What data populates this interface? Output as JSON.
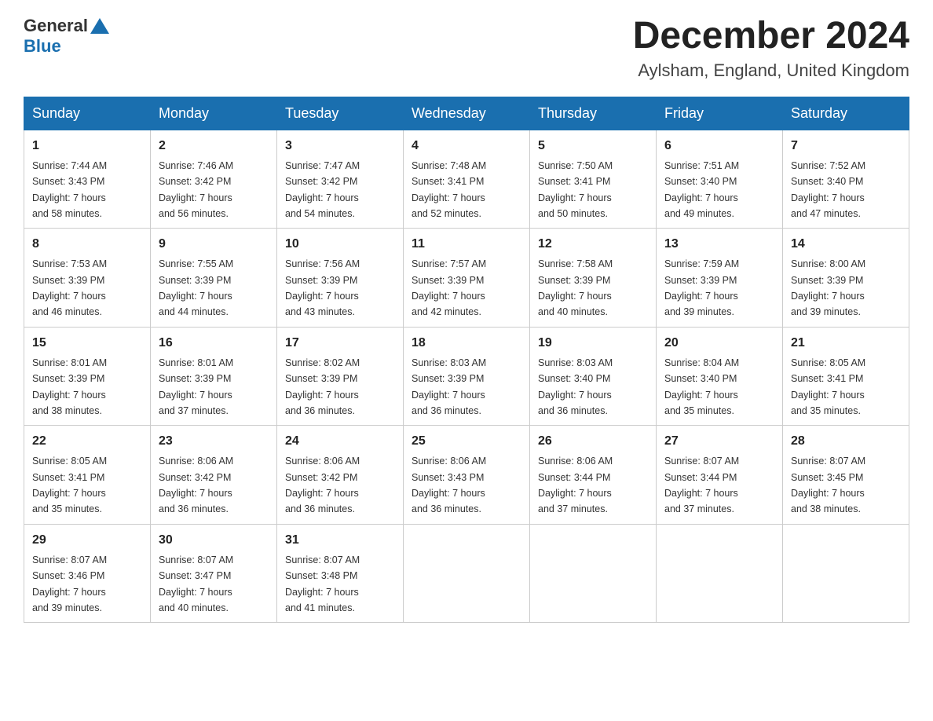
{
  "header": {
    "logo_general": "General",
    "logo_blue": "Blue",
    "month_title": "December 2024",
    "location": "Aylsham, England, United Kingdom"
  },
  "days_of_week": [
    "Sunday",
    "Monday",
    "Tuesday",
    "Wednesday",
    "Thursday",
    "Friday",
    "Saturday"
  ],
  "weeks": [
    [
      {
        "day": "1",
        "sunrise": "7:44 AM",
        "sunset": "3:43 PM",
        "daylight": "7 hours and 58 minutes."
      },
      {
        "day": "2",
        "sunrise": "7:46 AM",
        "sunset": "3:42 PM",
        "daylight": "7 hours and 56 minutes."
      },
      {
        "day": "3",
        "sunrise": "7:47 AM",
        "sunset": "3:42 PM",
        "daylight": "7 hours and 54 minutes."
      },
      {
        "day": "4",
        "sunrise": "7:48 AM",
        "sunset": "3:41 PM",
        "daylight": "7 hours and 52 minutes."
      },
      {
        "day": "5",
        "sunrise": "7:50 AM",
        "sunset": "3:41 PM",
        "daylight": "7 hours and 50 minutes."
      },
      {
        "day": "6",
        "sunrise": "7:51 AM",
        "sunset": "3:40 PM",
        "daylight": "7 hours and 49 minutes."
      },
      {
        "day": "7",
        "sunrise": "7:52 AM",
        "sunset": "3:40 PM",
        "daylight": "7 hours and 47 minutes."
      }
    ],
    [
      {
        "day": "8",
        "sunrise": "7:53 AM",
        "sunset": "3:39 PM",
        "daylight": "7 hours and 46 minutes."
      },
      {
        "day": "9",
        "sunrise": "7:55 AM",
        "sunset": "3:39 PM",
        "daylight": "7 hours and 44 minutes."
      },
      {
        "day": "10",
        "sunrise": "7:56 AM",
        "sunset": "3:39 PM",
        "daylight": "7 hours and 43 minutes."
      },
      {
        "day": "11",
        "sunrise": "7:57 AM",
        "sunset": "3:39 PM",
        "daylight": "7 hours and 42 minutes."
      },
      {
        "day": "12",
        "sunrise": "7:58 AM",
        "sunset": "3:39 PM",
        "daylight": "7 hours and 40 minutes."
      },
      {
        "day": "13",
        "sunrise": "7:59 AM",
        "sunset": "3:39 PM",
        "daylight": "7 hours and 39 minutes."
      },
      {
        "day": "14",
        "sunrise": "8:00 AM",
        "sunset": "3:39 PM",
        "daylight": "7 hours and 39 minutes."
      }
    ],
    [
      {
        "day": "15",
        "sunrise": "8:01 AM",
        "sunset": "3:39 PM",
        "daylight": "7 hours and 38 minutes."
      },
      {
        "day": "16",
        "sunrise": "8:01 AM",
        "sunset": "3:39 PM",
        "daylight": "7 hours and 37 minutes."
      },
      {
        "day": "17",
        "sunrise": "8:02 AM",
        "sunset": "3:39 PM",
        "daylight": "7 hours and 36 minutes."
      },
      {
        "day": "18",
        "sunrise": "8:03 AM",
        "sunset": "3:39 PM",
        "daylight": "7 hours and 36 minutes."
      },
      {
        "day": "19",
        "sunrise": "8:03 AM",
        "sunset": "3:40 PM",
        "daylight": "7 hours and 36 minutes."
      },
      {
        "day": "20",
        "sunrise": "8:04 AM",
        "sunset": "3:40 PM",
        "daylight": "7 hours and 35 minutes."
      },
      {
        "day": "21",
        "sunrise": "8:05 AM",
        "sunset": "3:41 PM",
        "daylight": "7 hours and 35 minutes."
      }
    ],
    [
      {
        "day": "22",
        "sunrise": "8:05 AM",
        "sunset": "3:41 PM",
        "daylight": "7 hours and 35 minutes."
      },
      {
        "day": "23",
        "sunrise": "8:06 AM",
        "sunset": "3:42 PM",
        "daylight": "7 hours and 36 minutes."
      },
      {
        "day": "24",
        "sunrise": "8:06 AM",
        "sunset": "3:42 PM",
        "daylight": "7 hours and 36 minutes."
      },
      {
        "day": "25",
        "sunrise": "8:06 AM",
        "sunset": "3:43 PM",
        "daylight": "7 hours and 36 minutes."
      },
      {
        "day": "26",
        "sunrise": "8:06 AM",
        "sunset": "3:44 PM",
        "daylight": "7 hours and 37 minutes."
      },
      {
        "day": "27",
        "sunrise": "8:07 AM",
        "sunset": "3:44 PM",
        "daylight": "7 hours and 37 minutes."
      },
      {
        "day": "28",
        "sunrise": "8:07 AM",
        "sunset": "3:45 PM",
        "daylight": "7 hours and 38 minutes."
      }
    ],
    [
      {
        "day": "29",
        "sunrise": "8:07 AM",
        "sunset": "3:46 PM",
        "daylight": "7 hours and 39 minutes."
      },
      {
        "day": "30",
        "sunrise": "8:07 AM",
        "sunset": "3:47 PM",
        "daylight": "7 hours and 40 minutes."
      },
      {
        "day": "31",
        "sunrise": "8:07 AM",
        "sunset": "3:48 PM",
        "daylight": "7 hours and 41 minutes."
      },
      null,
      null,
      null,
      null
    ]
  ],
  "labels": {
    "sunrise": "Sunrise:",
    "sunset": "Sunset:",
    "daylight": "Daylight:"
  }
}
